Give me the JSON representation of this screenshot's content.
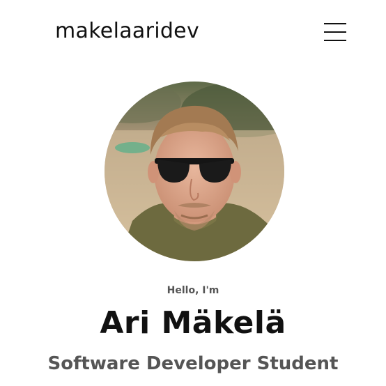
{
  "header": {
    "logo": "makelaaridev",
    "menu_icon": "hamburger-menu-icon"
  },
  "hero": {
    "avatar_alt": "profile-photo",
    "greeting": "Hello, I'm",
    "name": "Ari Mäkelä",
    "title": "Software Developer Student"
  }
}
